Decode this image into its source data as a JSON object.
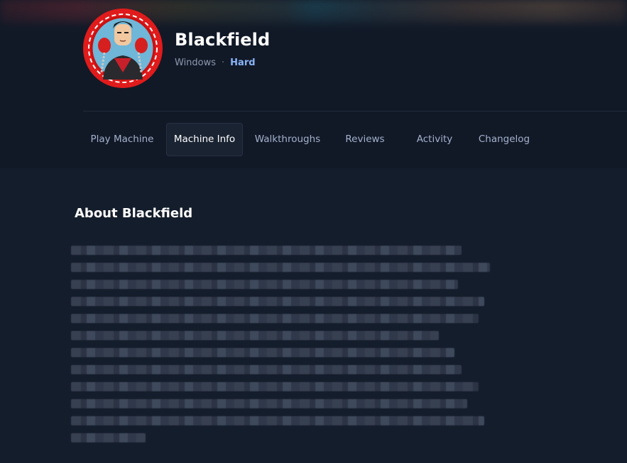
{
  "machine": {
    "name": "Blackfield",
    "os": "Windows",
    "separator": "·",
    "difficulty": "Hard",
    "accent_color": "#8ab4f8"
  },
  "tabs": [
    {
      "label": "Play Machine",
      "active": false
    },
    {
      "label": "Machine Info",
      "active": true
    },
    {
      "label": "Walkthroughs",
      "active": false
    },
    {
      "label": "Reviews",
      "active": false
    },
    {
      "label": "Activity",
      "active": false
    },
    {
      "label": "Changelog",
      "active": false
    }
  ],
  "about": {
    "title": "About Blackfield",
    "description_blurred": true
  },
  "colors": {
    "background": "#141d2b",
    "header": "#111927",
    "avatar_ring": "#e01b1b"
  }
}
